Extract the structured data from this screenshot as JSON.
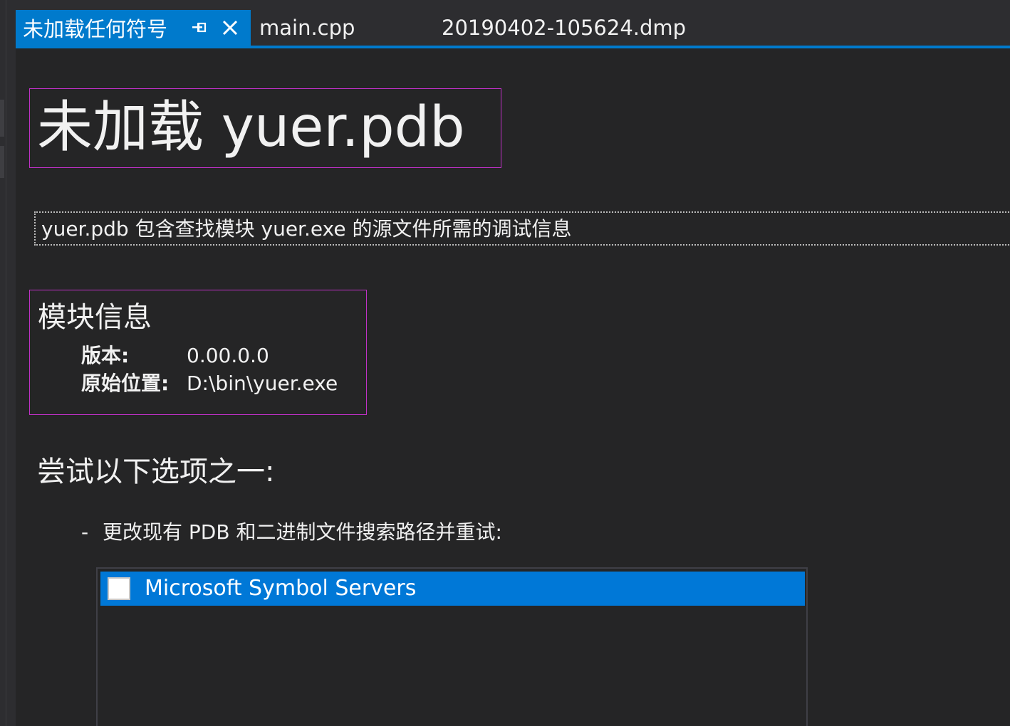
{
  "tabs": [
    {
      "label": "未加载任何符号",
      "active": true
    },
    {
      "label": "main.cpp",
      "active": false
    },
    {
      "label": "20190402-105624.dmp",
      "active": false
    }
  ],
  "page": {
    "title": "未加载 yuer.pdb",
    "description": "yuer.pdb 包含查找模块 yuer.exe 的源文件所需的调试信息"
  },
  "module_info": {
    "heading": "模块信息",
    "version_label": "版本:",
    "version_value": "0.00.0.0",
    "location_label": "原始位置:",
    "location_value": "D:\\bin\\yuer.exe"
  },
  "options": {
    "heading": "尝试以下选项之一:",
    "bullet": "-",
    "change_paths_text": "更改现有 PDB 和二进制文件搜索路径并重试:",
    "symbol_locations": [
      {
        "label": "Microsoft Symbol Servers",
        "checked": false,
        "selected": true
      }
    ]
  },
  "colors": {
    "accent": "#007acc",
    "selection": "#0078d7",
    "background": "#252526",
    "focus_border": "#c031c7"
  }
}
